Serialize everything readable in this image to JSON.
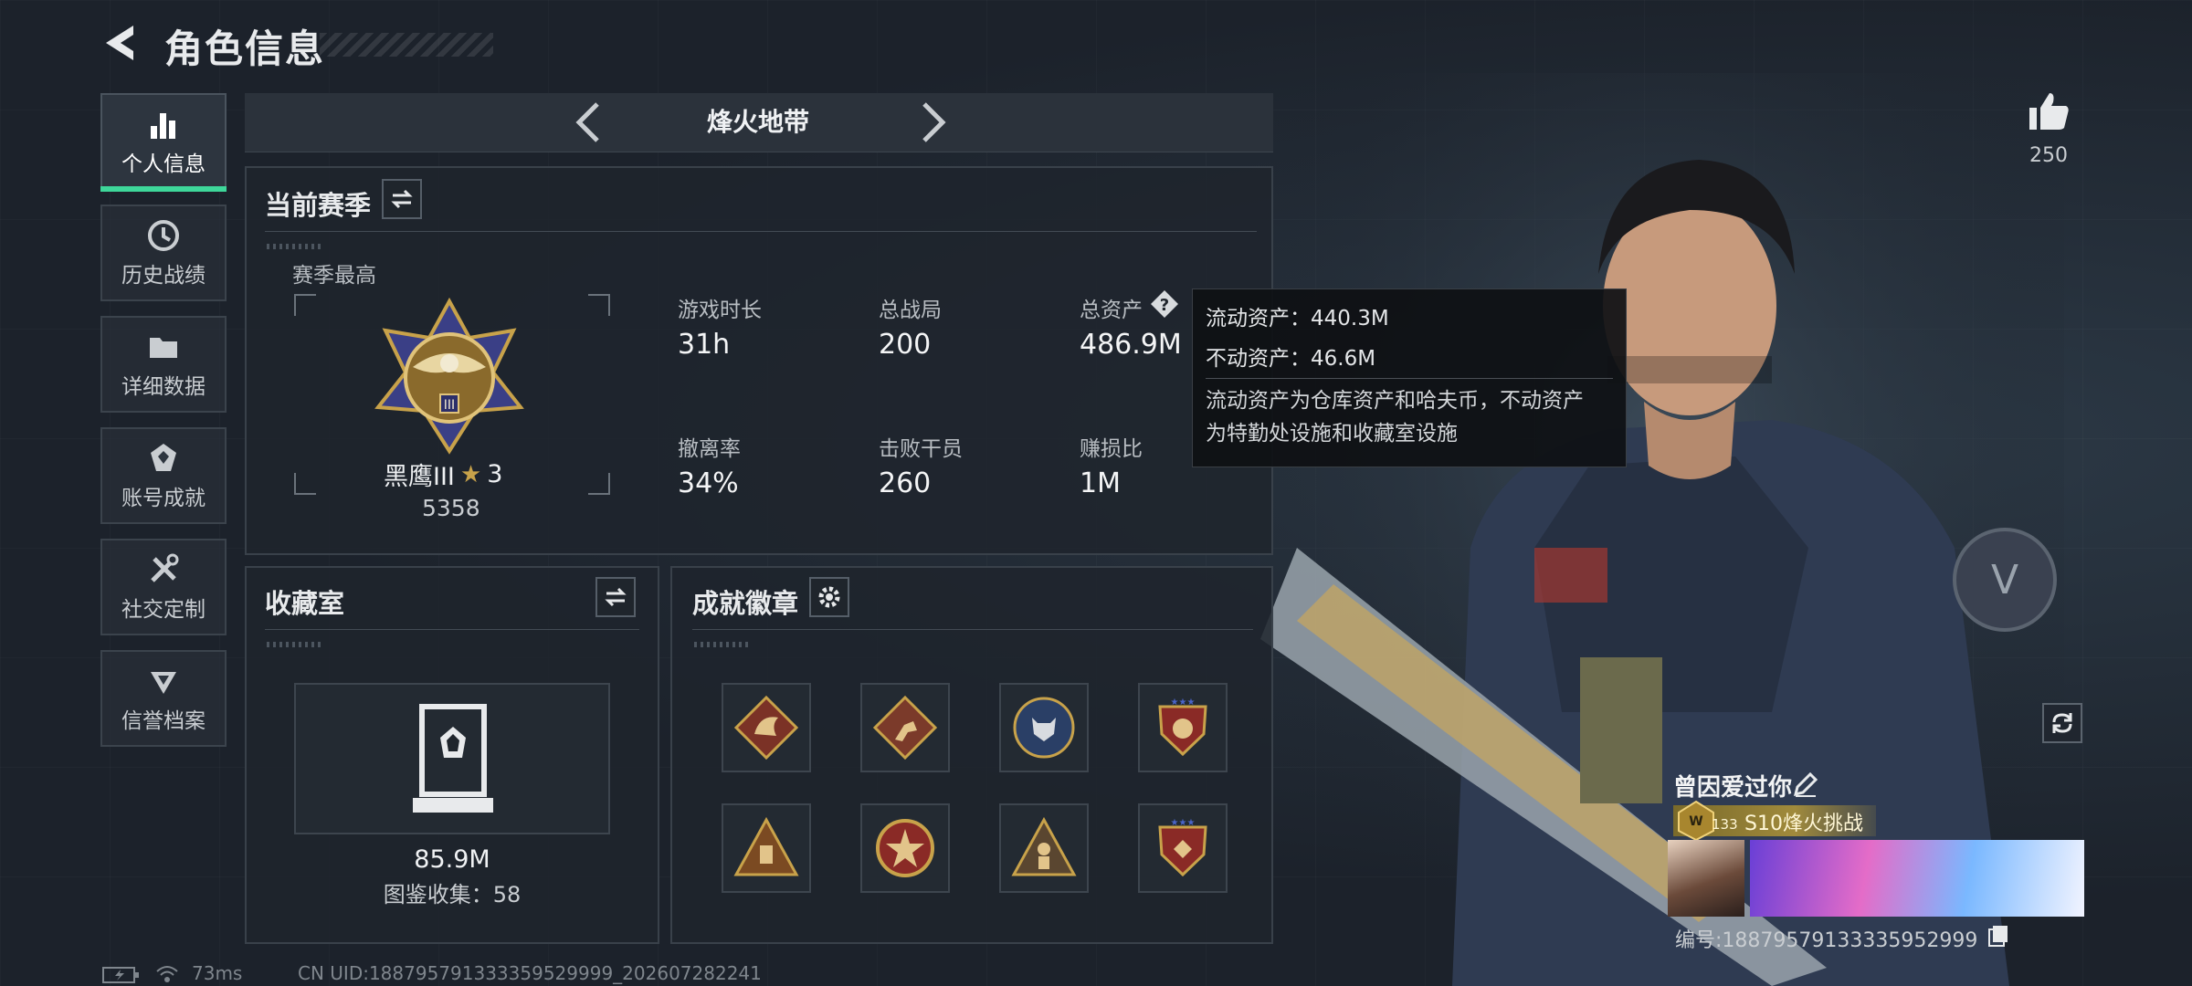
{
  "header": {
    "title": "角色信息"
  },
  "sidebar": {
    "items": [
      {
        "label": "个人信息",
        "icon": "bar-chart-icon",
        "active": true
      },
      {
        "label": "历史战绩",
        "icon": "history-icon"
      },
      {
        "label": "详细数据",
        "icon": "folder-icon"
      },
      {
        "label": "账号成就",
        "icon": "achievement-icon"
      },
      {
        "label": "社交定制",
        "icon": "tools-icon"
      },
      {
        "label": "信誉档案",
        "icon": "reputation-icon"
      }
    ]
  },
  "mode": {
    "title": "烽火地带"
  },
  "season": {
    "title": "当前赛季",
    "best_label": "赛季最高",
    "rank_name": "黑鹰III",
    "rank_stars": "3",
    "rank_score": "5358",
    "stats": [
      {
        "label": "游戏时长",
        "value": "31h"
      },
      {
        "label": "总战局",
        "value": "200"
      },
      {
        "label": "总资产",
        "value": "486.9M"
      },
      {
        "label": "撤离率",
        "value": "34%"
      },
      {
        "label": "击败干员",
        "value": "260"
      },
      {
        "label": "赚损比",
        "value": "1M"
      }
    ]
  },
  "tooltip": {
    "liquid": "流动资产：440.3M",
    "fixed": "不动资产：46.6M",
    "desc_line1": "流动资产为仓库资产和哈夫币，不动资产",
    "desc_line2": "为特勤处设施和收藏室设施"
  },
  "collection": {
    "title": "收藏室",
    "value": "85.9M",
    "count_label": "图鉴收集：58"
  },
  "badges": {
    "title": "成就徽章"
  },
  "social": {
    "likes": "250",
    "player_name": "曾因爱过你",
    "level": "133",
    "season_tag": "S10烽火挑战",
    "id_label": "编号:18879579133335952999"
  },
  "footer": {
    "ping": "73ms",
    "uid": "CN UID:188795791333359529999_202607282241"
  },
  "colors": {
    "accent": "#3ed79a",
    "gold": "#c8a24a"
  }
}
